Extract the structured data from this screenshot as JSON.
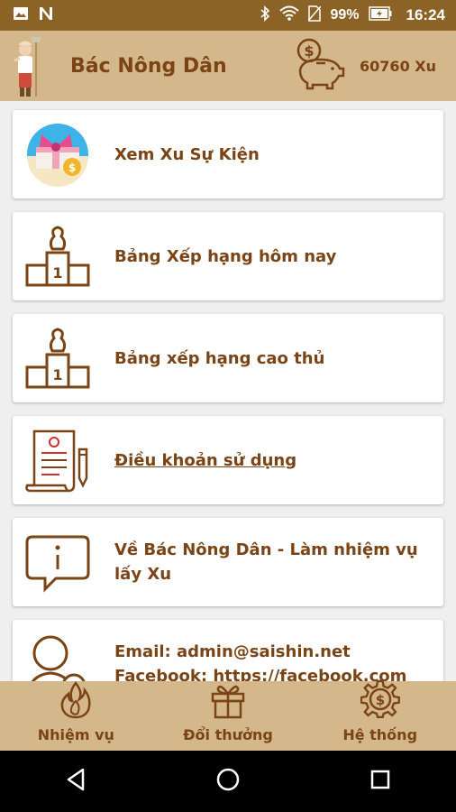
{
  "status_bar": {
    "battery": "99%",
    "time": "16:24"
  },
  "header": {
    "title": "Bác Nông Dân",
    "coins": "60760 Xu"
  },
  "menu": [
    {
      "label": "Xem Xu Sự Kiện",
      "icon": "gift-coin-icon"
    },
    {
      "label": "Bảng Xếp hạng hôm nay",
      "icon": "podium-icon"
    },
    {
      "label": "Bảng xếp hạng cao thủ",
      "icon": "podium-icon"
    },
    {
      "label": "Điều khoản sử dụng",
      "icon": "document-pen-icon"
    },
    {
      "label": "Về Bác Nông Dân - Làm nhiệm vụ lấy Xu",
      "icon": "info-bubble-icon"
    },
    {
      "label": "Email: admin@saishin.net",
      "label2": "Facebook: https://facebook.com",
      "icon": "user-contact-icon"
    }
  ],
  "tabs": [
    {
      "label": "Nhiệm vụ",
      "icon": "fire-icon"
    },
    {
      "label": "Đổi thưởng",
      "icon": "gift-icon"
    },
    {
      "label": "Hệ thống",
      "icon": "gear-coin-icon"
    }
  ],
  "colors": {
    "status_bar": "#8b6326",
    "header": "#d4b88c",
    "text": "#7b4416"
  }
}
